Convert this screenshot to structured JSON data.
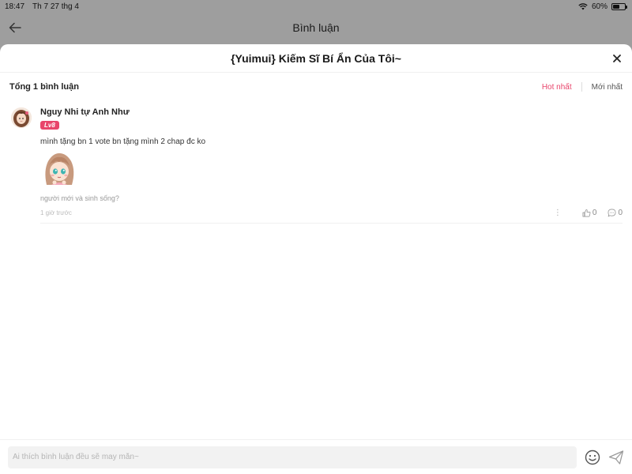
{
  "status_bar": {
    "time": "18:47",
    "date": "Th 7 27 thg 4",
    "battery_percent": "60%",
    "battery_level": 0.6
  },
  "background_page": {
    "title": "Bình luận"
  },
  "sheet": {
    "title": "{Yuimui} Kiếm Sĩ Bí Ẩn Của Tôi~"
  },
  "summary": {
    "total_label": "Tổng 1 bình luận",
    "sort_options": [
      "Hot nhất",
      "Mới nhất"
    ],
    "active_sort": "Hot nhất"
  },
  "comments": [
    {
      "username": "Nguy Nhi tự Anh Như",
      "level": "Lv8",
      "text": "mình tặng bn 1 vote bn tặng mình 2 chap đc ko",
      "sticker_caption": "người mới và sinh sống?",
      "timestamp": "1 giờ trước",
      "likes": "0",
      "replies": "0"
    }
  ],
  "input": {
    "placeholder": "Ai thích bình luận đều sẽ may mắn~",
    "value": ""
  },
  "colors": {
    "accent": "#e8456b",
    "dim_background": "#9e9e9e"
  },
  "icons": {
    "back": "arrow-left-icon",
    "close": "close-icon",
    "like": "thumbs-up-icon",
    "reply": "speech-bubble-icon",
    "emoji": "smiley-icon",
    "send": "paper-plane-icon",
    "wifi": "wifi-icon",
    "battery": "battery-icon"
  }
}
